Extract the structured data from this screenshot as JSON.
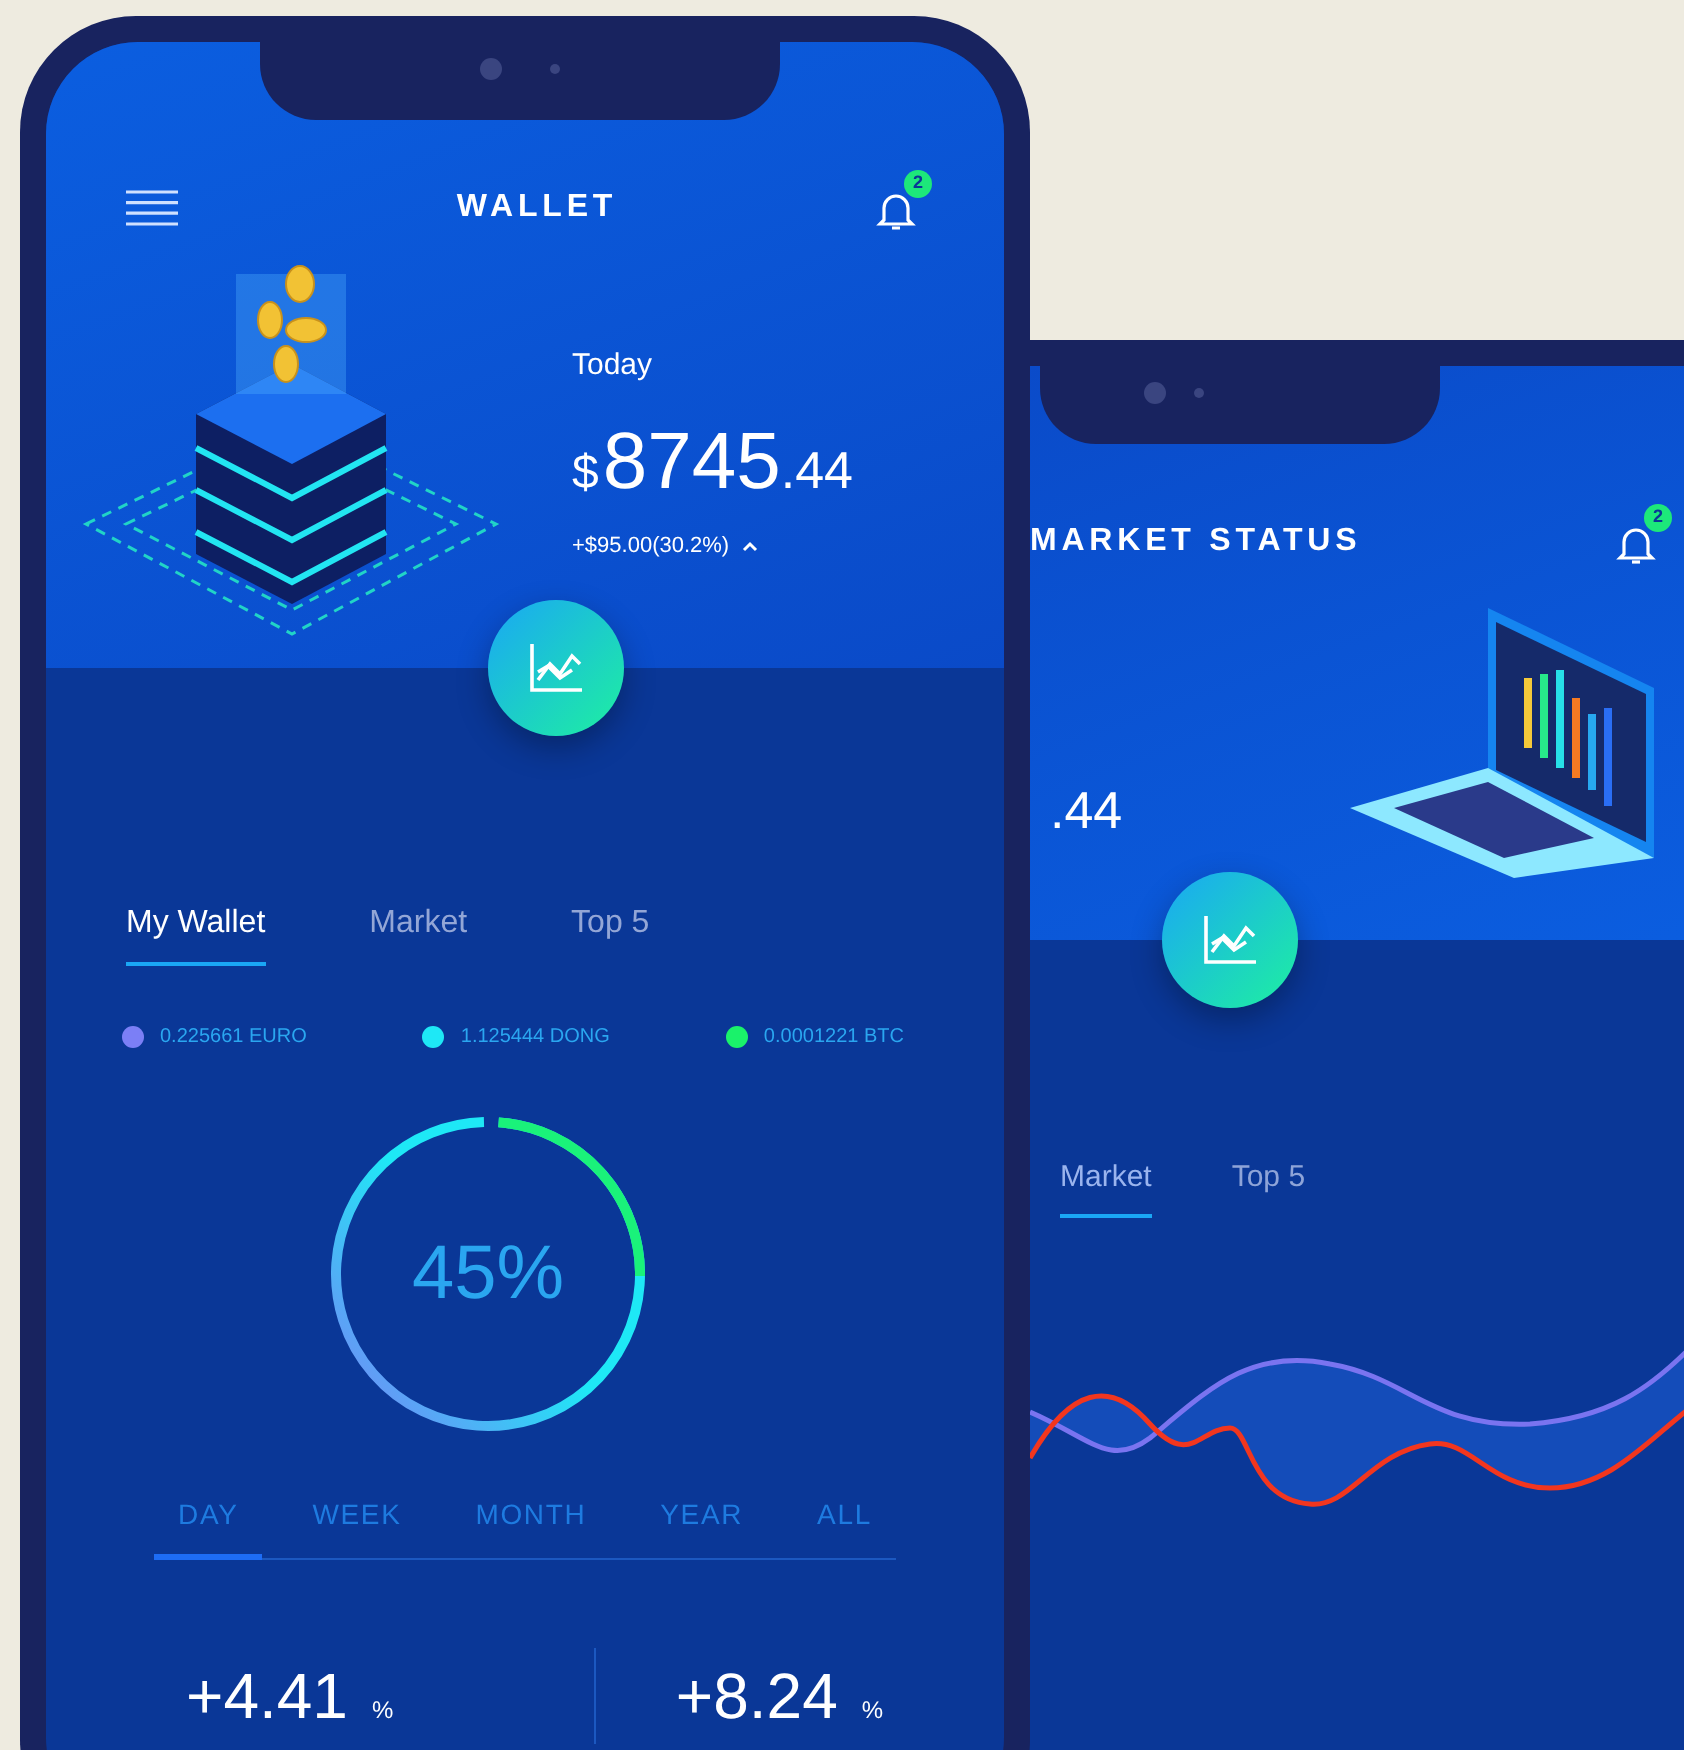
{
  "wallet_screen": {
    "title": "WALLET",
    "notification_count": "2",
    "today_label": "Today",
    "balance": {
      "currency": "$",
      "whole": "8745",
      "fraction": ".44"
    },
    "change": "+$95.00(30.2%)",
    "tabs": [
      {
        "label": "My Wallet",
        "selected": true
      },
      {
        "label": "Market",
        "selected": false
      },
      {
        "label": "Top 5",
        "selected": false
      }
    ],
    "legend": [
      {
        "label": "0.225661 EURO",
        "color": "#7b7ff6"
      },
      {
        "label": "1.125444 DONG",
        "color": "#1ee8f6"
      },
      {
        "label": "0.0001221 BTC",
        "color": "#1af26a"
      }
    ],
    "donut_label": "45%",
    "periods": [
      {
        "label": "DAY",
        "selected": true
      },
      {
        "label": "WEEK",
        "selected": false
      },
      {
        "label": "MONTH",
        "selected": false
      },
      {
        "label": "YEAR",
        "selected": false
      },
      {
        "label": "ALL",
        "selected": false
      }
    ],
    "stats": [
      {
        "value": "+4.41",
        "unit": "%"
      },
      {
        "value": "+8.24",
        "unit": "%"
      }
    ]
  },
  "market_screen": {
    "title": "MARKET STATUS",
    "notification_count": "2",
    "balance_fragment": ".44",
    "tabs": [
      {
        "label": "Market",
        "selected": true
      },
      {
        "label": "Top 5",
        "selected": false
      }
    ]
  }
}
